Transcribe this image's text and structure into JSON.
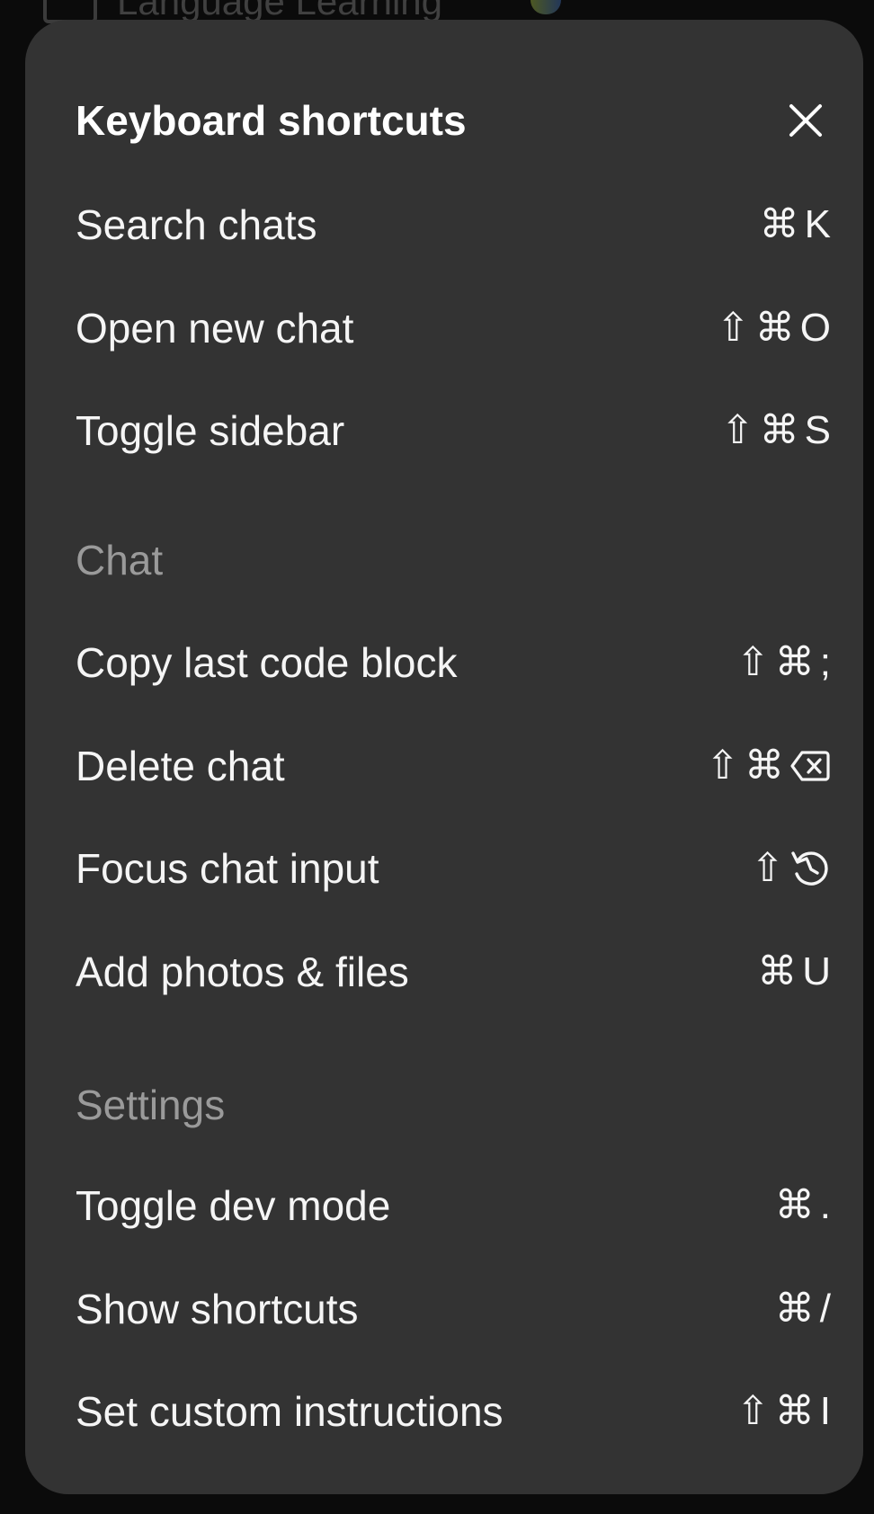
{
  "background": {
    "window_title": "Language Learning"
  },
  "modal": {
    "title": "Keyboard shortcuts",
    "close_icon": "close-icon"
  },
  "general": [
    {
      "label": "Search chats",
      "keys": [
        "⌘",
        "K"
      ]
    },
    {
      "label": "Open new chat",
      "keys": [
        "⇧",
        "⌘",
        "O"
      ]
    },
    {
      "label": "Toggle sidebar",
      "keys": [
        "⇧",
        "⌘",
        "S"
      ]
    }
  ],
  "chat_section": {
    "heading": "Chat",
    "items": [
      {
        "label": "Copy last code block",
        "keys": [
          "⇧",
          "⌘",
          ";"
        ]
      },
      {
        "label": "Delete chat",
        "keys": [
          "⇧",
          "⌘",
          "delete-icon"
        ]
      },
      {
        "label": "Focus chat input",
        "keys": [
          "⇧",
          "escape-icon"
        ]
      },
      {
        "label": "Add photos & files",
        "keys": [
          "⌘",
          "U"
        ]
      }
    ]
  },
  "settings_section": {
    "heading": "Settings",
    "items": [
      {
        "label": "Toggle dev mode",
        "keys": [
          "⌘",
          "."
        ]
      },
      {
        "label": "Show shortcuts",
        "keys": [
          "⌘",
          "/"
        ]
      },
      {
        "label": "Set custom instructions",
        "keys": [
          "⇧",
          "⌘",
          "I"
        ]
      }
    ]
  },
  "colors": {
    "modal_bg": "#333333",
    "text": "#f5f5f5",
    "section_heading": "#9a9a9a",
    "backdrop": "#0b0b0b"
  }
}
